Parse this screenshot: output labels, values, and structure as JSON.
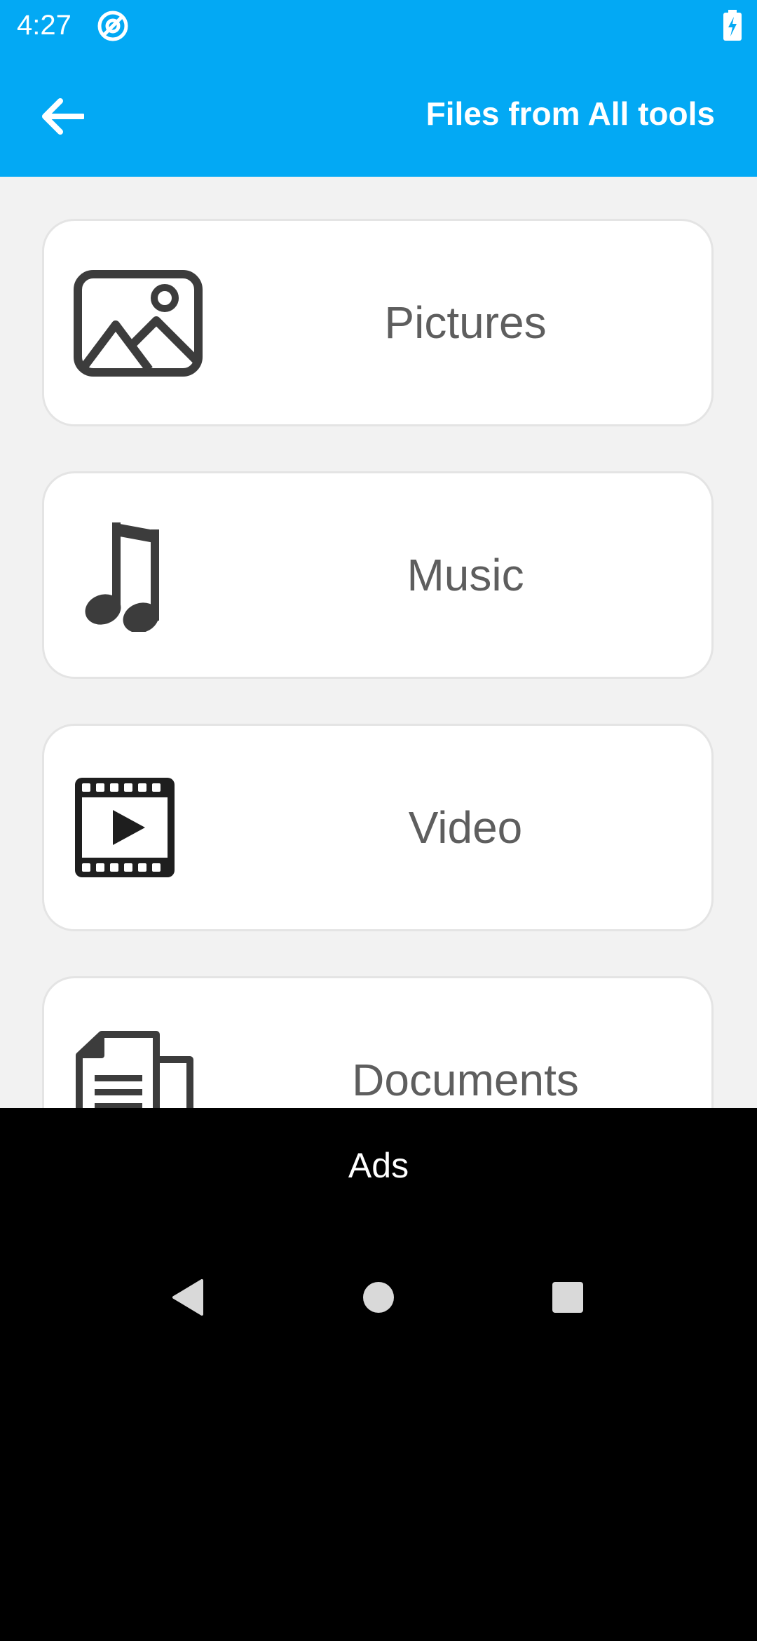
{
  "status_bar": {
    "time": "4:27",
    "app_icon": "location-tracking-icon",
    "battery_icon": "battery-charging-icon"
  },
  "app_bar": {
    "title": "Files from All tools",
    "back_icon": "arrow-left-icon"
  },
  "categories": [
    {
      "label": "Pictures",
      "icon": "image-icon"
    },
    {
      "label": "Music",
      "icon": "music-note-icon"
    },
    {
      "label": "Video",
      "icon": "film-play-icon"
    },
    {
      "label": "Documents",
      "icon": "documents-icon"
    }
  ],
  "ads": {
    "label": "Ads"
  },
  "nav_bar": {
    "back_icon": "nav-back-icon",
    "home_icon": "nav-home-icon",
    "recents_icon": "nav-recents-icon"
  },
  "colors": {
    "primary": "#03A9F4",
    "background": "#F2F2F2",
    "card": "#FFFFFF",
    "card_border": "#E4E4E4",
    "label_text": "#5E5E5E",
    "icon": "#3C3C3C",
    "nav": "#000000"
  }
}
